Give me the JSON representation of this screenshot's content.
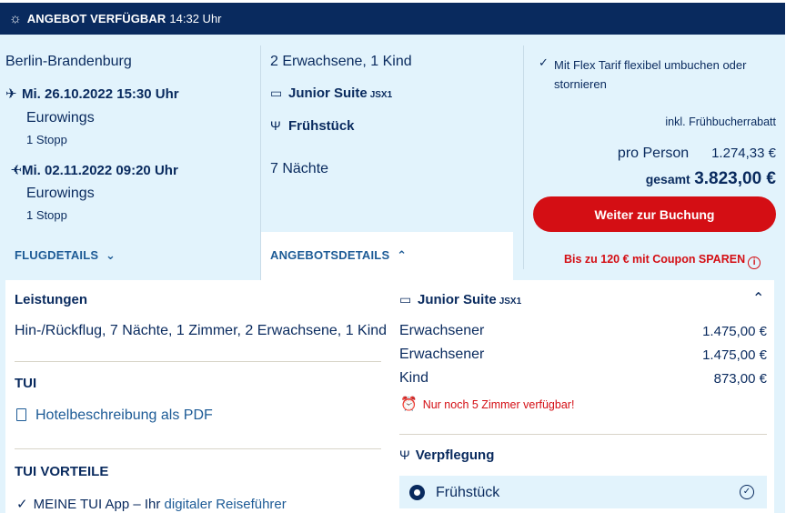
{
  "header": {
    "title": "ANGEBOT VERFÜGBAR",
    "time": "14:32 Uhr"
  },
  "flight": {
    "airport": "Berlin-Brandenburg",
    "outbound": {
      "datetime": "Mi. 26.10.2022 15:30 Uhr",
      "airline": "Eurowings",
      "stops": "1 Stopp"
    },
    "inbound": {
      "datetime": "Mi. 02.11.2022 09:20 Uhr",
      "airline": "Eurowings",
      "stops": "1 Stopp"
    },
    "details_link": "FLUGDETAILS"
  },
  "room": {
    "travellers": "2 Erwachsene, 1 Kind",
    "room_name": "Junior Suite",
    "room_code": "JSX1",
    "board": "Frühstück",
    "nights": "7 Nächte",
    "details_link": "ANGEBOTSDETAILS"
  },
  "price": {
    "flex": "Mit Flex Tarif flexibel umbuchen oder stornieren",
    "flex_line1": "Mit Flex Tarif flexibel umbuchen oder",
    "flex_line2": "stornieren",
    "early_bird": "inkl. Frühbucherrabatt",
    "per_person_label": "pro Person",
    "per_person_value": "1.274,33 €",
    "total_label": "gesamt",
    "total_value": "3.823,00 €",
    "book_button": "Weiter zur Buchung",
    "coupon": "Bis zu 120 € mit Coupon SPAREN"
  },
  "details": {
    "leistungen_title": "Leistungen",
    "leistungen_text": "Hin-/Rückflug, 7 Nächte, 1 Zimmer, 2 Erwachsene, 1 Kind",
    "tui_title": "TUI",
    "pdf_link": "Hotelbeschreibung als PDF",
    "vorteile_title": "TUI VORTEILE",
    "vorteile_item_prefix": "MEINE TUI App – Ihr ",
    "vorteile_item_link": "digitaler Reiseführer",
    "room_title": "Junior Suite",
    "room_code": "JSX1",
    "prices": [
      {
        "label": "Erwachsener",
        "value": "1.475,00 €"
      },
      {
        "label": "Erwachsener",
        "value": "1.475,00 €"
      },
      {
        "label": "Kind",
        "value": "873,00 €"
      }
    ],
    "availability": "Nur noch 5 Zimmer verfügbar!",
    "verpflegung_title": "Verpflegung",
    "verpflegung_option": "Frühstück"
  },
  "colors": {
    "navy": "#092a5e",
    "light_blue": "#e2f3fc",
    "red": "#d40e14",
    "link": "#1d5b96"
  }
}
